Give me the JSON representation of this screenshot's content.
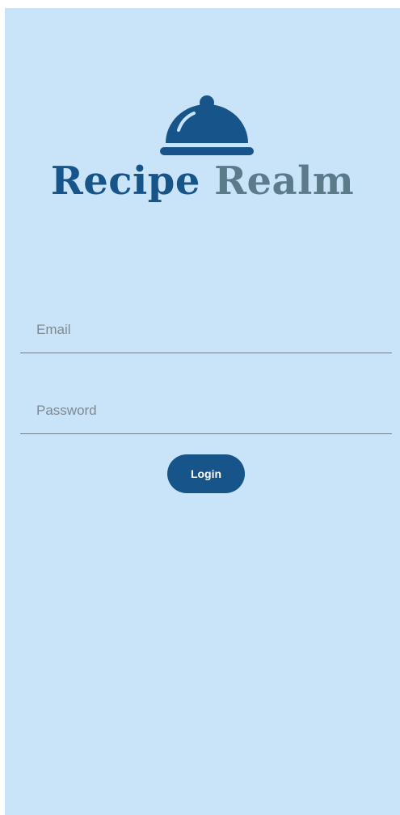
{
  "app": {
    "brand_part1": "Recipe",
    "brand_part2": "Realm",
    "logo_icon": "cloche-icon"
  },
  "form": {
    "email_placeholder": "Email",
    "email_value": "",
    "password_placeholder": "Password",
    "password_value": "",
    "login_label": "Login"
  },
  "colors": {
    "background": "#c9e3f8",
    "primary": "#17548a",
    "secondary": "#5b7b8b",
    "underline": "#6f7f8c"
  }
}
